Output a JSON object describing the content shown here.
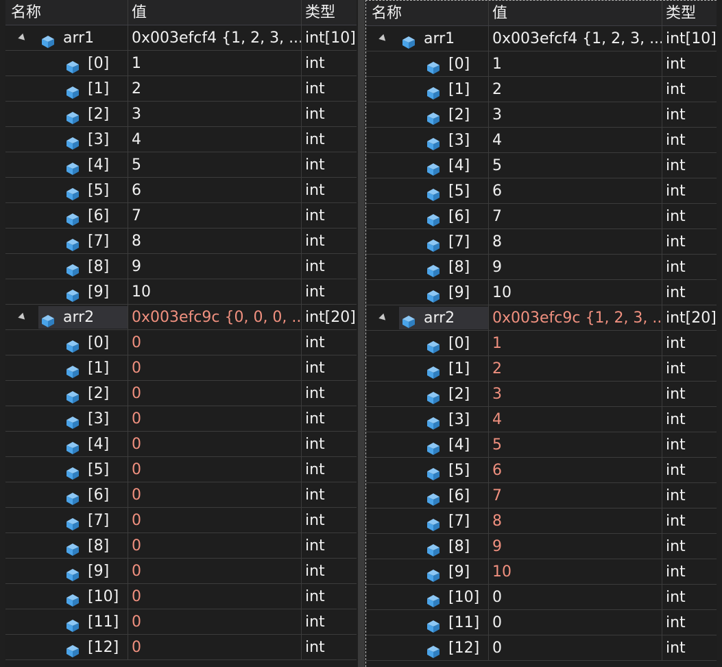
{
  "headers": {
    "name": "名称",
    "value": "值",
    "type": "类型"
  },
  "colors": {
    "changed": "#f0907f",
    "icon": "#4aa3e8"
  },
  "icons": {
    "expand": "collapse-triangle-icon",
    "variable": "variable-cube-icon"
  },
  "left": {
    "arr1": {
      "name": "arr1",
      "value": "0x003efcf4 {1, 2, 3, ...",
      "type": "int[10]",
      "items": [
        {
          "index": "[0]",
          "value": "1",
          "type": "int"
        },
        {
          "index": "[1]",
          "value": "2",
          "type": "int"
        },
        {
          "index": "[2]",
          "value": "3",
          "type": "int"
        },
        {
          "index": "[3]",
          "value": "4",
          "type": "int"
        },
        {
          "index": "[4]",
          "value": "5",
          "type": "int"
        },
        {
          "index": "[5]",
          "value": "6",
          "type": "int"
        },
        {
          "index": "[6]",
          "value": "7",
          "type": "int"
        },
        {
          "index": "[7]",
          "value": "8",
          "type": "int"
        },
        {
          "index": "[8]",
          "value": "9",
          "type": "int"
        },
        {
          "index": "[9]",
          "value": "10",
          "type": "int"
        }
      ]
    },
    "arr2": {
      "name": "arr2",
      "value": "0x003efc9c {0, 0, 0, ...",
      "type": "int[20]",
      "items": [
        {
          "index": "[0]",
          "value": "0",
          "type": "int",
          "changed": true
        },
        {
          "index": "[1]",
          "value": "0",
          "type": "int",
          "changed": true
        },
        {
          "index": "[2]",
          "value": "0",
          "type": "int",
          "changed": true
        },
        {
          "index": "[3]",
          "value": "0",
          "type": "int",
          "changed": true
        },
        {
          "index": "[4]",
          "value": "0",
          "type": "int",
          "changed": true
        },
        {
          "index": "[5]",
          "value": "0",
          "type": "int",
          "changed": true
        },
        {
          "index": "[6]",
          "value": "0",
          "type": "int",
          "changed": true
        },
        {
          "index": "[7]",
          "value": "0",
          "type": "int",
          "changed": true
        },
        {
          "index": "[8]",
          "value": "0",
          "type": "int",
          "changed": true
        },
        {
          "index": "[9]",
          "value": "0",
          "type": "int",
          "changed": true
        },
        {
          "index": "[10]",
          "value": "0",
          "type": "int",
          "changed": true
        },
        {
          "index": "[11]",
          "value": "0",
          "type": "int",
          "changed": true
        },
        {
          "index": "[12]",
          "value": "0",
          "type": "int",
          "changed": true
        }
      ]
    }
  },
  "right": {
    "arr1": {
      "name": "arr1",
      "value": "0x003efcf4 {1, 2, 3, ...",
      "type": "int[10]",
      "items": [
        {
          "index": "[0]",
          "value": "1",
          "type": "int"
        },
        {
          "index": "[1]",
          "value": "2",
          "type": "int"
        },
        {
          "index": "[2]",
          "value": "3",
          "type": "int"
        },
        {
          "index": "[3]",
          "value": "4",
          "type": "int"
        },
        {
          "index": "[4]",
          "value": "5",
          "type": "int"
        },
        {
          "index": "[5]",
          "value": "6",
          "type": "int"
        },
        {
          "index": "[6]",
          "value": "7",
          "type": "int"
        },
        {
          "index": "[7]",
          "value": "8",
          "type": "int"
        },
        {
          "index": "[8]",
          "value": "9",
          "type": "int"
        },
        {
          "index": "[9]",
          "value": "10",
          "type": "int"
        }
      ]
    },
    "arr2": {
      "name": "arr2",
      "value": "0x003efc9c {1, 2, 3, ...",
      "type": "int[20]",
      "items": [
        {
          "index": "[0]",
          "value": "1",
          "type": "int",
          "changed": true
        },
        {
          "index": "[1]",
          "value": "2",
          "type": "int",
          "changed": true
        },
        {
          "index": "[2]",
          "value": "3",
          "type": "int",
          "changed": true
        },
        {
          "index": "[3]",
          "value": "4",
          "type": "int",
          "changed": true
        },
        {
          "index": "[4]",
          "value": "5",
          "type": "int",
          "changed": true
        },
        {
          "index": "[5]",
          "value": "6",
          "type": "int",
          "changed": true
        },
        {
          "index": "[6]",
          "value": "7",
          "type": "int",
          "changed": true
        },
        {
          "index": "[7]",
          "value": "8",
          "type": "int",
          "changed": true
        },
        {
          "index": "[8]",
          "value": "9",
          "type": "int",
          "changed": true
        },
        {
          "index": "[9]",
          "value": "10",
          "type": "int",
          "changed": true
        },
        {
          "index": "[10]",
          "value": "0",
          "type": "int"
        },
        {
          "index": "[11]",
          "value": "0",
          "type": "int"
        },
        {
          "index": "[12]",
          "value": "0",
          "type": "int"
        }
      ]
    }
  }
}
